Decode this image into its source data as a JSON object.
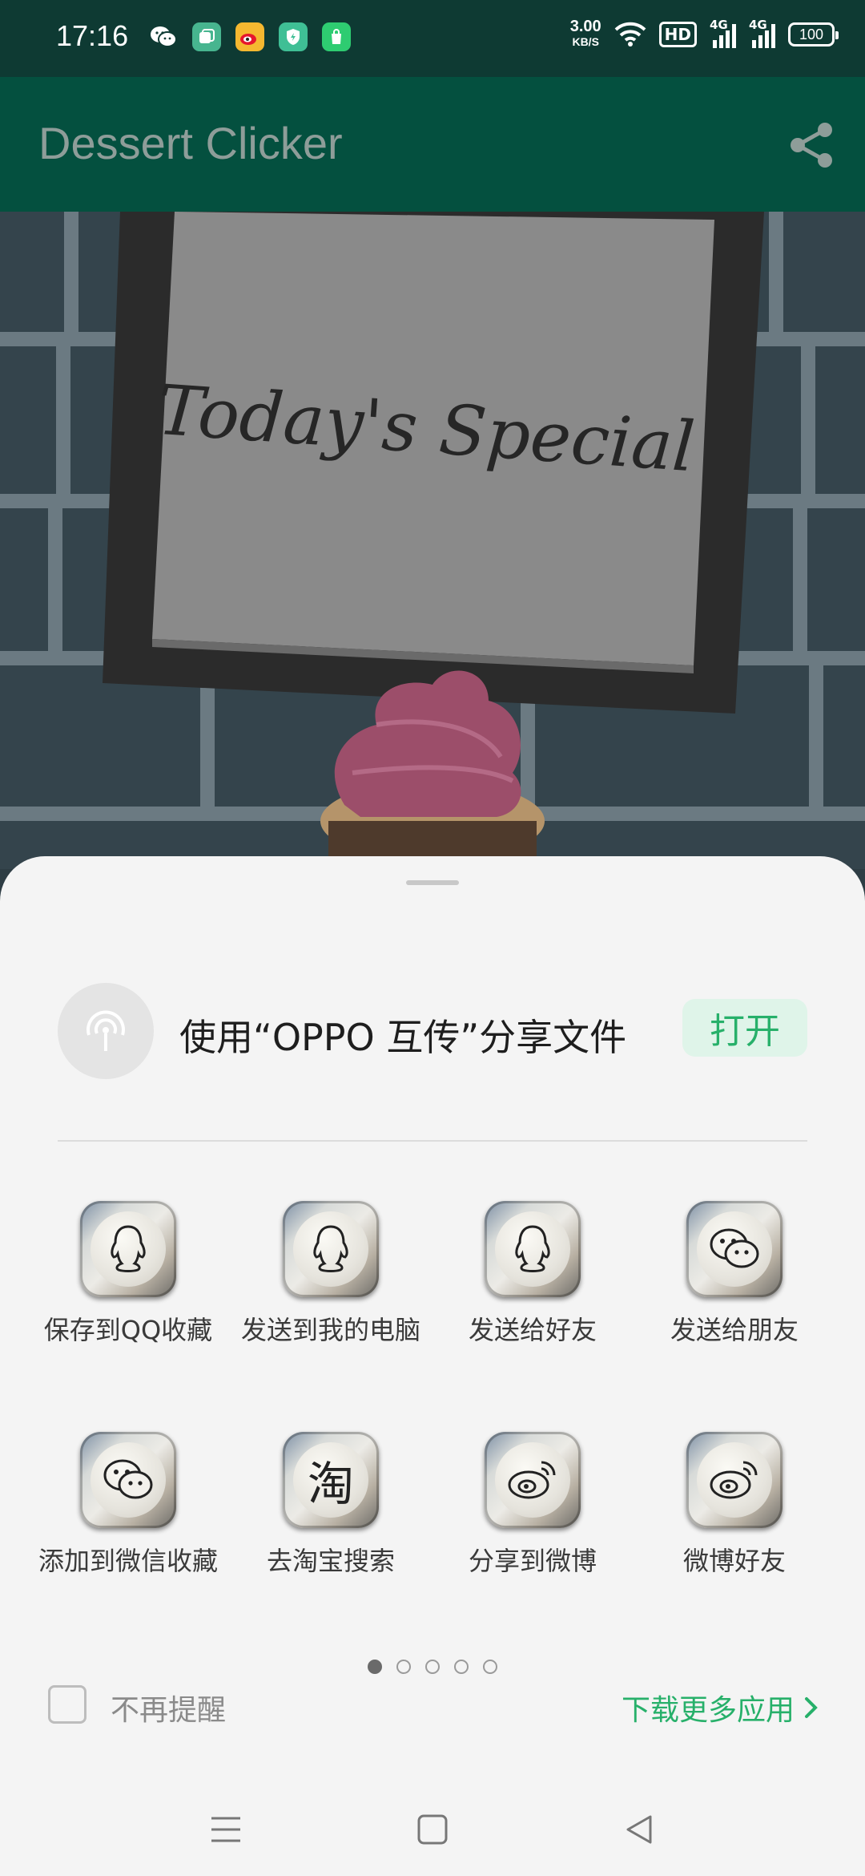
{
  "status": {
    "time": "17:16",
    "net_speed_value": "3.00",
    "net_speed_unit": "KB/S",
    "hd_label": "HD",
    "sim1_label": "4G",
    "sim2_label": "4G",
    "battery": "100"
  },
  "app_bar": {
    "title": "Dessert Clicker",
    "share_icon": "share-icon"
  },
  "hero": {
    "sign_text": "Today's Special"
  },
  "share_sheet": {
    "oppo": {
      "text": "使用“OPPO 互传”分享文件",
      "button": "打开"
    },
    "items": [
      {
        "label": "保存到QQ收藏",
        "icon": "qq-icon"
      },
      {
        "label": "发送到我的电脑",
        "icon": "qq-icon"
      },
      {
        "label": "发送给好友",
        "icon": "qq-icon"
      },
      {
        "label": "发送给朋友",
        "icon": "wechat-icon"
      },
      {
        "label": "添加到微信收藏",
        "icon": "wechat-icon"
      },
      {
        "label": "去淘宝搜索",
        "icon": "taobao-icon",
        "glyph": "淘"
      },
      {
        "label": "分享到微博",
        "icon": "weibo-icon"
      },
      {
        "label": "微博好友",
        "icon": "weibo-icon"
      }
    ],
    "page_dots": {
      "count": 5,
      "active": 1
    },
    "dont_remind": "不再提醒",
    "more_apps": "下载更多应用"
  },
  "colors": {
    "status_bar": "#0e3a33",
    "app_bar": "#04503f",
    "accent_green": "#27b06a",
    "sheet_bg": "#f4f4f4"
  }
}
